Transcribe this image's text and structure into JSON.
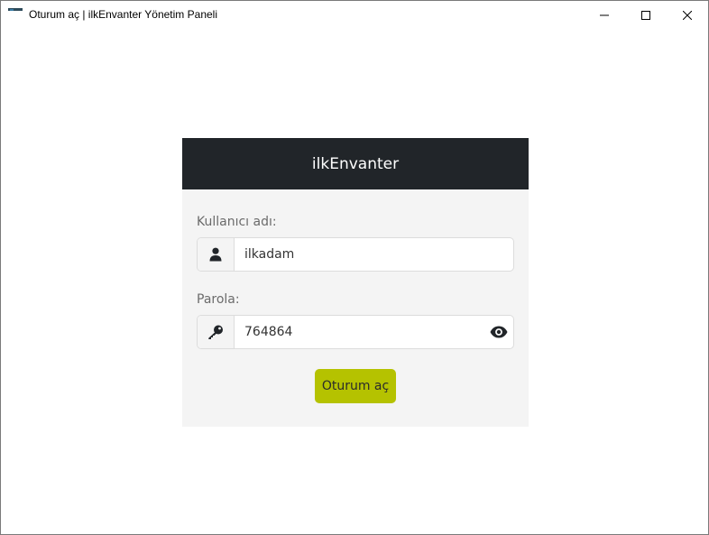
{
  "window": {
    "title": "Oturum aç | ilkEnvanter Yönetim Paneli"
  },
  "login": {
    "header": "ilkEnvanter",
    "username_label": "Kullanıcı adı:",
    "username_value": "ilkadam",
    "password_label": "Parola:",
    "password_value": "764864",
    "submit_label": "Oturum aç"
  },
  "colors": {
    "header_bg": "#212529",
    "card_bg": "#f4f4f4",
    "submit_bg": "#b5c200"
  },
  "icons": {
    "username": "user-icon",
    "password": "key-icon",
    "reveal": "eye-icon"
  }
}
